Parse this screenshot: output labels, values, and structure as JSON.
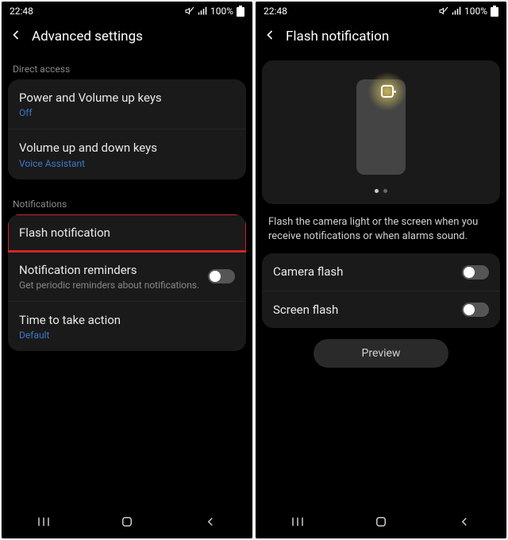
{
  "status": {
    "time": "22:48",
    "battery_pct": "100%"
  },
  "left": {
    "title": "Advanced settings",
    "section1": "Direct access",
    "row1": {
      "title": "Power and Volume up keys",
      "sub": "Off"
    },
    "row2": {
      "title": "Volume up and down keys",
      "sub": "Voice Assistant"
    },
    "section2": "Notifications",
    "row3": {
      "title": "Flash notification"
    },
    "row4": {
      "title": "Notification reminders",
      "hint": "Get periodic reminders about notifications."
    },
    "row5": {
      "title": "Time to take action",
      "sub": "Default"
    }
  },
  "right": {
    "title": "Flash notification",
    "desc": "Flash the camera light or the screen when you receive notifications or when alarms sound.",
    "row1": "Camera flash",
    "row2": "Screen flash",
    "preview": "Preview"
  }
}
